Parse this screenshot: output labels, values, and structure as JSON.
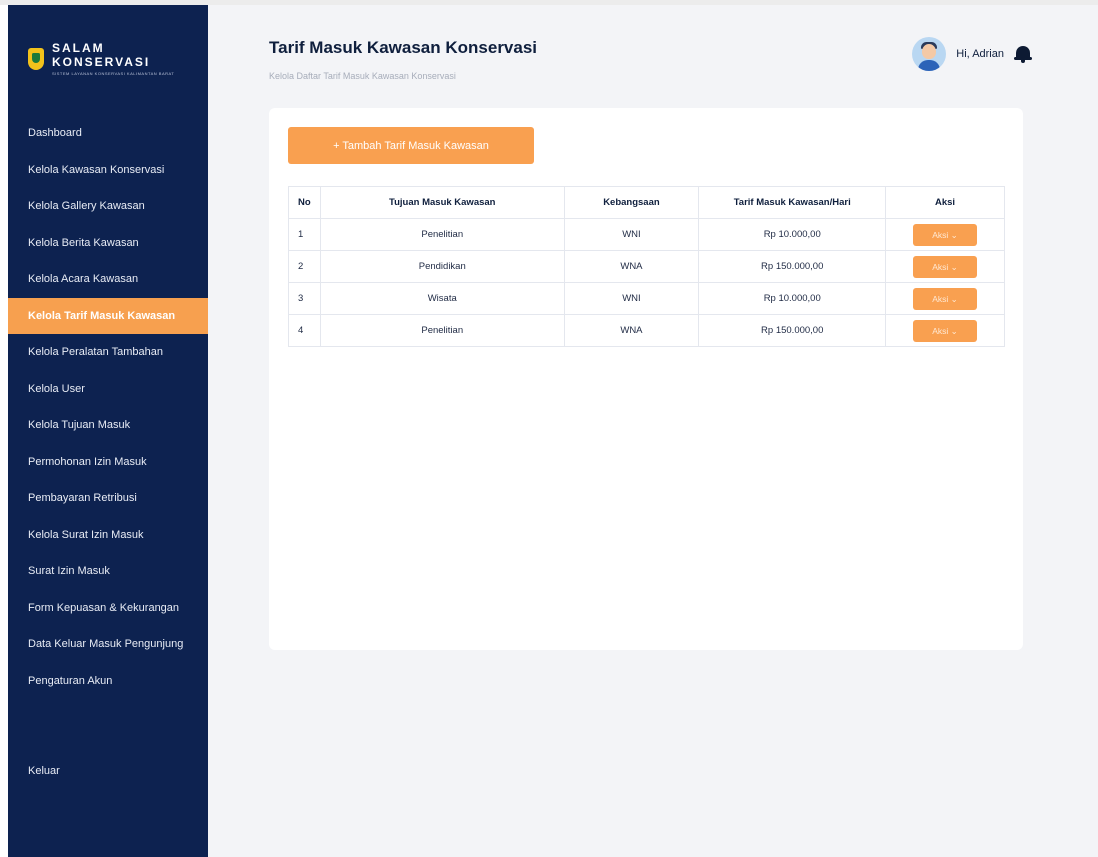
{
  "brand": {
    "title": "SALAM KONSERVASI",
    "subtitle": "SISTEM LAYANAN KONSERVASI KALIMANTAN BARAT"
  },
  "sidebar": {
    "items": [
      {
        "label": "Dashboard",
        "active": false
      },
      {
        "label": "Kelola Kawasan Konservasi",
        "active": false
      },
      {
        "label": "Kelola Gallery Kawasan",
        "active": false
      },
      {
        "label": "Kelola Berita Kawasan",
        "active": false
      },
      {
        "label": "Kelola Acara Kawasan",
        "active": false
      },
      {
        "label": "Kelola Tarif Masuk Kawasan",
        "active": true
      },
      {
        "label": "Kelola Peralatan Tambahan",
        "active": false
      },
      {
        "label": "Kelola User",
        "active": false
      },
      {
        "label": "Kelola Tujuan Masuk",
        "active": false
      },
      {
        "label": "Permohonan Izin Masuk",
        "active": false
      },
      {
        "label": "Pembayaran Retribusi",
        "active": false
      },
      {
        "label": "Kelola Surat Izin Masuk",
        "active": false
      },
      {
        "label": "Surat Izin Masuk",
        "active": false
      },
      {
        "label": "Form Kepuasan & Kekurangan",
        "active": false
      },
      {
        "label": "Data Keluar Masuk Pengunjung",
        "active": false
      },
      {
        "label": "Pengaturan Akun",
        "active": false
      }
    ],
    "logout_label": "Keluar"
  },
  "header": {
    "title": "Tarif Masuk Kawasan Konservasi",
    "subtitle": "Kelola Daftar Tarif Masuk Kawasan Konservasi",
    "greeting": "Hi, Adrian",
    "icons": {
      "avatar": "user-avatar",
      "notifications": "bell-icon"
    }
  },
  "main": {
    "add_button_label": "+ Tambah Tarif Masuk Kawasan",
    "table": {
      "headers": [
        "No",
        "Tujuan Masuk Kawasan",
        "Kebangsaan",
        "Tarif Masuk Kawasan/Hari",
        "Aksi"
      ],
      "rows": [
        [
          "1",
          "Penelitian",
          "WNI",
          "Rp 10.000,00",
          "Aksi ⌄"
        ],
        [
          "2",
          "Pendidikan",
          "WNA",
          "Rp 150.000,00",
          "Aksi ⌄"
        ],
        [
          "3",
          "Wisata",
          "WNI",
          "Rp 10.000,00",
          "Aksi ⌄"
        ],
        [
          "4",
          "Penelitian",
          "WNA",
          "Rp 150.000,00",
          "Aksi ⌄"
        ]
      ]
    }
  },
  "colors": {
    "sidebar_bg": "#0d2250",
    "accent": "#f9a050",
    "page_bg": "#f3f4f7"
  }
}
